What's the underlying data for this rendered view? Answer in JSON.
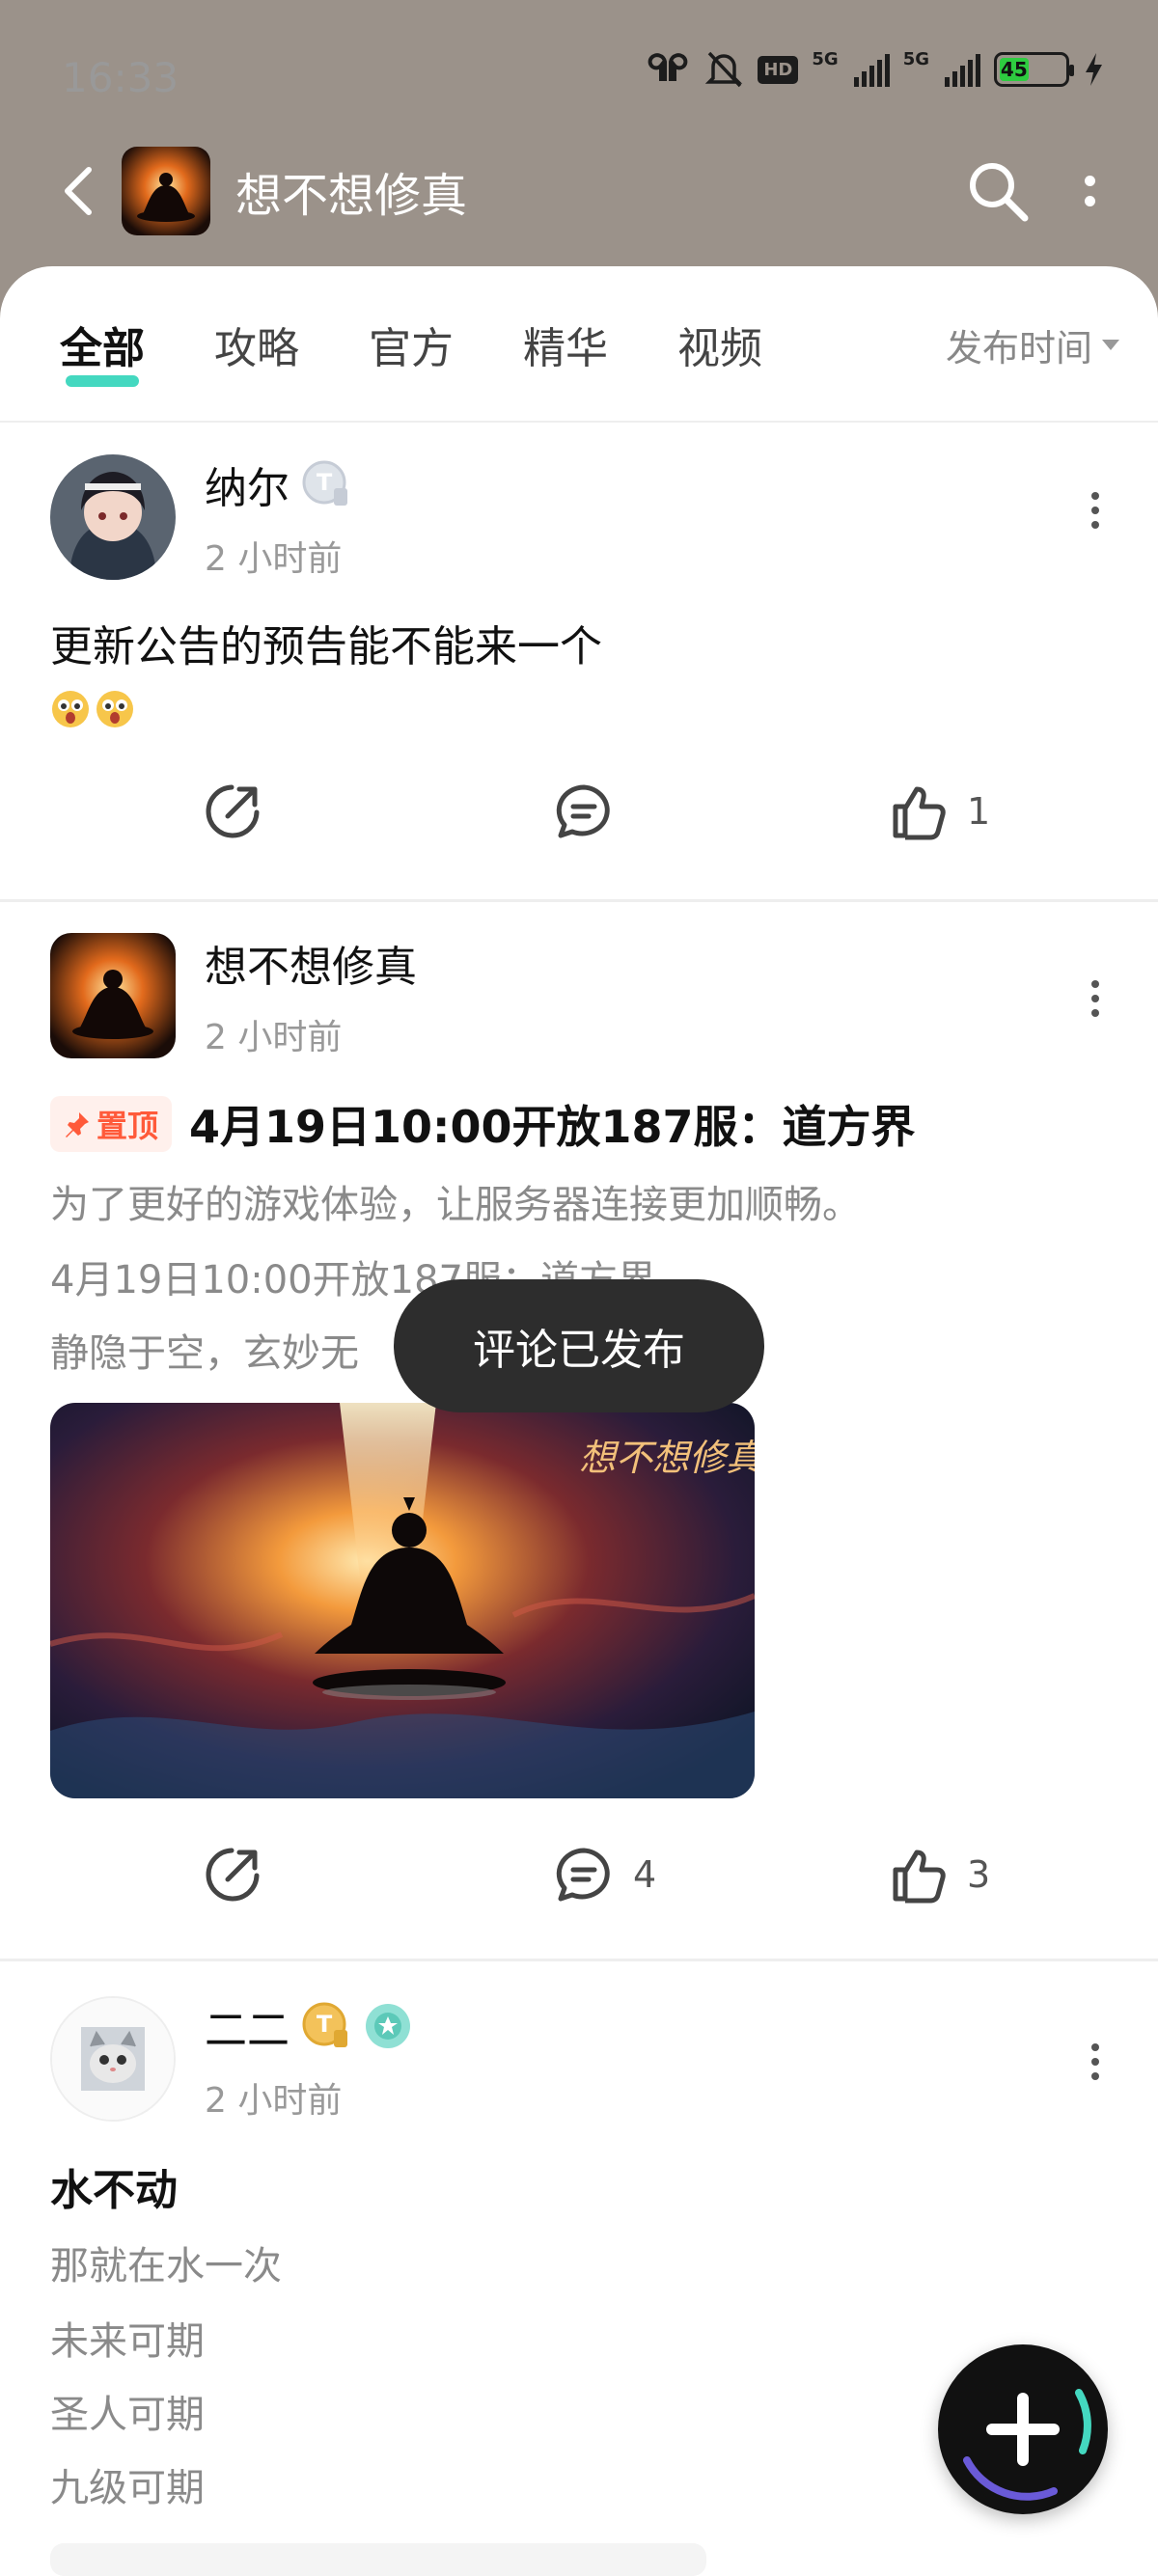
{
  "status_bar": {
    "time": "16:33",
    "hd_label": "HD",
    "network_label_1": "5G",
    "network_label_2": "5G",
    "battery_level": "45",
    "icons": [
      "earbuds-icon",
      "bell-muted-icon",
      "hd-icon",
      "signal-icon",
      "signal-icon",
      "battery-icon",
      "charging-icon"
    ]
  },
  "app_bar": {
    "title": "想不想修真",
    "icons": [
      "back-icon",
      "search-icon",
      "more-icon"
    ]
  },
  "tabs": {
    "items": [
      "全部",
      "攻略",
      "官方",
      "精华",
      "视频"
    ],
    "active_index": 0,
    "sort_label": "发布时间"
  },
  "posts": [
    {
      "author": "纳尔",
      "time": "2 小时前",
      "title": "更新公告的预告能不能来一个",
      "emoji": "😲😲",
      "share_count": "",
      "comment_count": "",
      "like_count": "1"
    },
    {
      "author": "想不想修真",
      "time": "2 小时前",
      "pin_label": "置顶",
      "title": "4月19日10:00开放187服：道方界",
      "lines": [
        "为了更好的游戏体验，让服务器连接更加顺畅。",
        "4月19日10:00开放187服：道方界",
        "静隐于空，玄妙无"
      ],
      "image_caption": "想不想修真",
      "comment_count": "4",
      "like_count": "3"
    },
    {
      "author": "二二",
      "time": "2 小时前",
      "title": "水不动",
      "lines": [
        "那就在水一次",
        "未来可期",
        "圣人可期",
        "九级可期"
      ]
    }
  ],
  "toast": "评论已发布",
  "colors": {
    "header_bg": "#9b928a",
    "tab_indicator": "#44d8c0",
    "pin_text": "#ff5a3a",
    "battery_fill": "#2ecc40"
  }
}
